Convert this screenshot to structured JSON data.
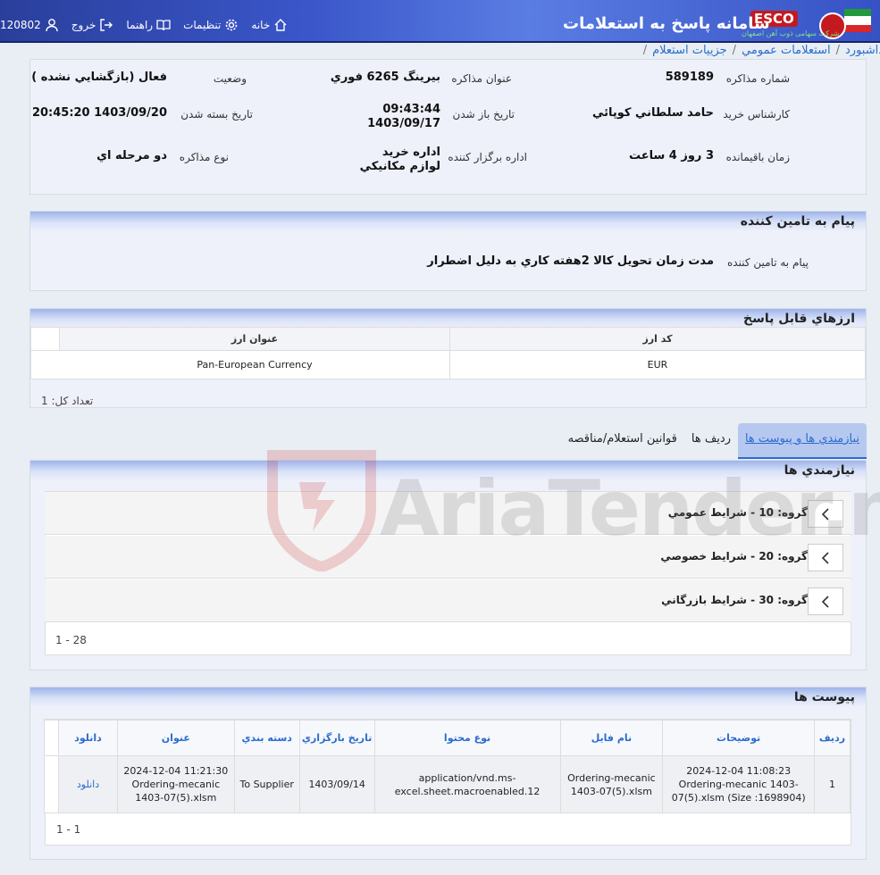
{
  "header": {
    "app_title": "سامانه پاسخ به استعلامات",
    "esco": "ESCO",
    "esco_sub": "شرکت سهامی ذوب آهن اصفهان",
    "nav": {
      "user_id": "120802",
      "logout": "خروج",
      "help": "راهنما",
      "settings": "تنظیمات",
      "home": "خانه"
    }
  },
  "breadcrumb": [
    "داشبورد",
    "استعلامات عمومي",
    "جزييات استعلام"
  ],
  "summary": {
    "number_label": "شماره مذاکره",
    "number_value": "589189",
    "title_label": "عنوان مذاکره",
    "title_value": "بيرينگ 6265 فوري",
    "status_label": "وضعيت",
    "status_value": "فعال (بازگشايي نشده )",
    "expert_label": "کارشناس خريد",
    "expert_value": "حامد سلطاني کوپائي",
    "open_label": "تاريخ باز شدن",
    "open_time": "09:43:44",
    "open_date": "1403/09/17",
    "close_label": "تاريخ بسته شدن",
    "close_value": "1403/09/20 20:45:20",
    "remaining_label": "زمان باقيمانده",
    "remaining_value": "3 روز 4 ساعت",
    "org_label": "اداره برگزار کننده",
    "org_value": "اداره خريد لوازم مکانيکي",
    "type_label": "نوع مذاکره",
    "type_value": "دو مرحله اي"
  },
  "supplier_message": {
    "heading": "پيام به تامين کننده",
    "label": "پيام به تامين کننده",
    "value": "مدت زمان تحويل کالا 2هفته کاري به دليل اضطرار"
  },
  "currencies": {
    "heading": "ارزهاي قابل پاسخ",
    "columns": [
      "کد ارز",
      "عنوان ارز"
    ],
    "rows": [
      [
        "EUR",
        "Pan-European Currency"
      ]
    ],
    "count": "تعداد کل: 1"
  },
  "tabs": [
    "نيازمندي ها و پيوست ها",
    "رديف ها",
    "قوانين استعلام/مناقصه"
  ],
  "requirements": {
    "heading": "نيازمندي ها",
    "groups": [
      "گروه: 10 - شرايط عمومي",
      "گروه: 20 - شرايط خصوصي",
      "گروه: 30 - شرايط بازرگاني"
    ],
    "pager": "1 - 28"
  },
  "attachments": {
    "heading": "پيوست ها",
    "columns": [
      "رديف",
      "توضيحات",
      "نام فايل",
      "نوع محتوا",
      "تاريخ بارگزاري",
      "دسته بندي",
      "عنوان",
      "دانلود"
    ],
    "rows": [
      [
        "1",
        "2024-12-04 11:08:23 Ordering-mecanic 1403-07(5).xlsm (Size :1698904)",
        "Ordering-mecanic 1403-07(5).xlsm",
        "application/vnd.ms-excel.sheet.macroenabled.12",
        "1403/09/14",
        "To Supplier",
        "2024-12-04 11:21:30 Ordering-mecanic 1403-07(5).xlsm",
        "دانلود"
      ]
    ],
    "pager": "1 - 1"
  },
  "watermark": "AriaTender.neT"
}
